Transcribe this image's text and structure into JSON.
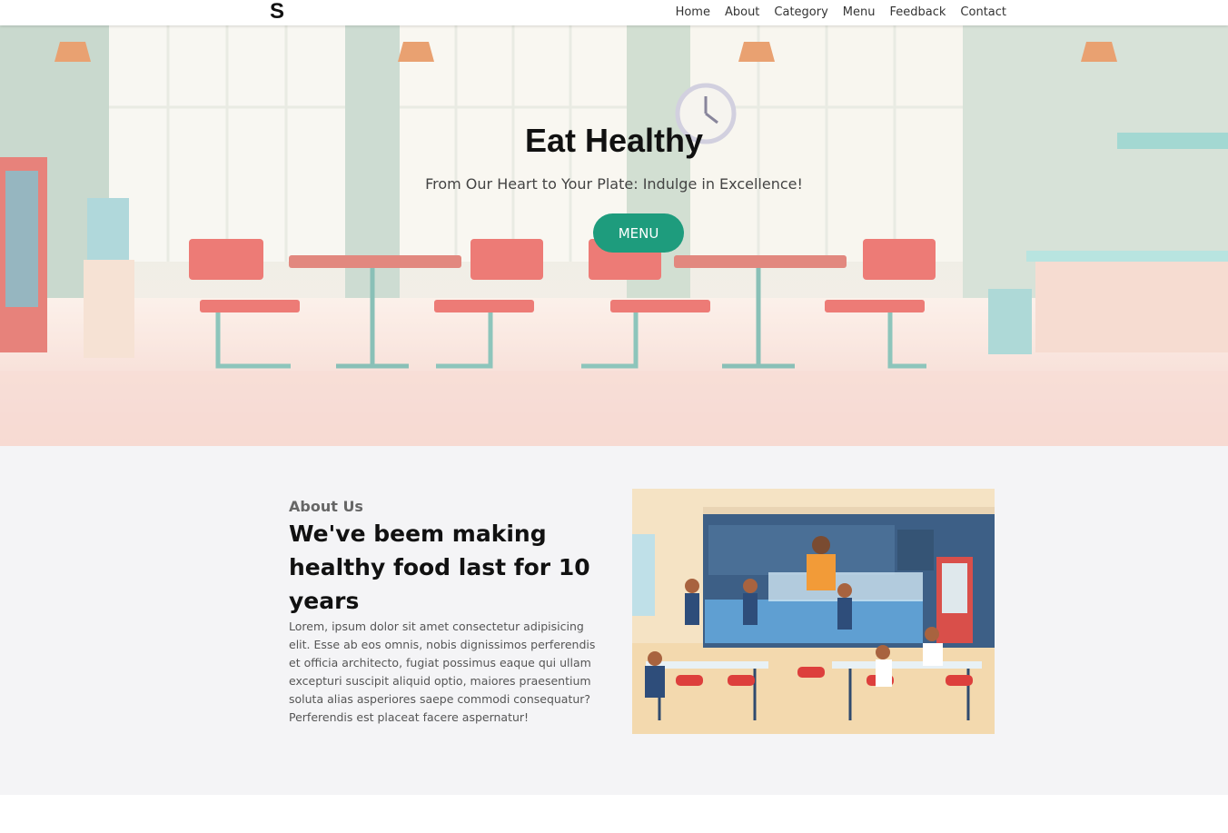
{
  "header": {
    "logo": "S",
    "nav": [
      "Home",
      "About",
      "Category",
      "Menu",
      "Feedback",
      "Contact"
    ]
  },
  "hero": {
    "title": "Eat Healthy",
    "subtitle": "From Our Heart to Your Plate: Indulge in Excellence!",
    "button_label": "MENU"
  },
  "about": {
    "label": "About Us",
    "heading": "We've beem making healthy food last for 10 years",
    "text": "Lorem, ipsum dolor sit amet consectetur adipisicing elit. Esse ab eos omnis, nobis dignissimos perferendis et officia architecto, fugiat possimus eaque qui ullam excepturi suscipit aliquid optio, maiores praesentium soluta alias asperiores saepe commodi consequatur? Perferendis est placeat facere aspernatur!"
  },
  "colors": {
    "accent": "#1e9c7d",
    "section_bg": "#f4f4f6"
  }
}
